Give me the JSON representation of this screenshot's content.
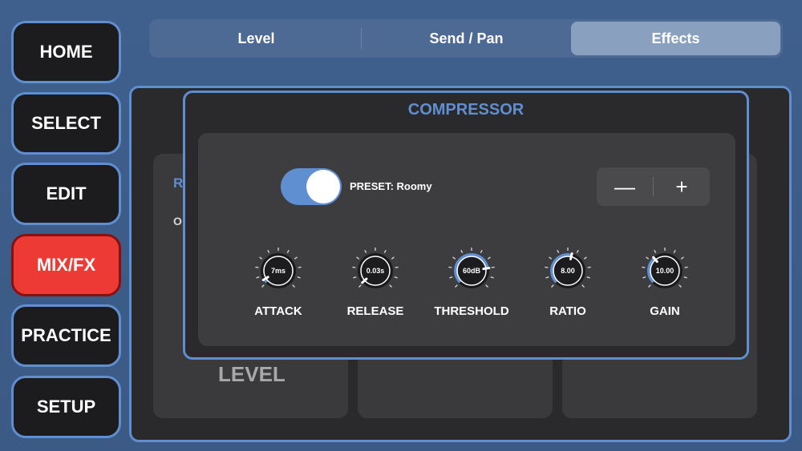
{
  "nav": {
    "items": [
      {
        "label": "HOME",
        "active": false
      },
      {
        "label": "SELECT",
        "active": false
      },
      {
        "label": "EDIT",
        "active": false
      },
      {
        "label": "MIX/FX",
        "active": true
      },
      {
        "label": "PRACTICE",
        "active": false
      },
      {
        "label": "SETUP",
        "active": false
      }
    ]
  },
  "tabs": [
    {
      "label": "Level",
      "active": false
    },
    {
      "label": "Send / Pan",
      "active": false
    },
    {
      "label": "Effects",
      "active": true
    }
  ],
  "background": {
    "partial_heading": "R",
    "partial_text": "O",
    "level_label": "LEVEL"
  },
  "compressor": {
    "title": "COMPRESSOR",
    "enabled": true,
    "preset_text": "PRESET: Roomy",
    "stepper": {
      "minus": "—",
      "plus": "+"
    },
    "knobs": [
      {
        "label": "ATTACK",
        "value": "7ms",
        "level": 0.05
      },
      {
        "label": "RELEASE",
        "value": "0.03s",
        "level": 0.01
      },
      {
        "label": "THRESHOLD",
        "value": "60dB",
        "level": 0.8
      },
      {
        "label": "RATIO",
        "value": "8.00",
        "level": 0.55
      },
      {
        "label": "GAIN",
        "value": "10.00",
        "level": 0.35
      }
    ]
  },
  "colors": {
    "accent": "#5f8fd0",
    "active_nav": "#ee3a35",
    "panel": "#2a2a2c"
  }
}
